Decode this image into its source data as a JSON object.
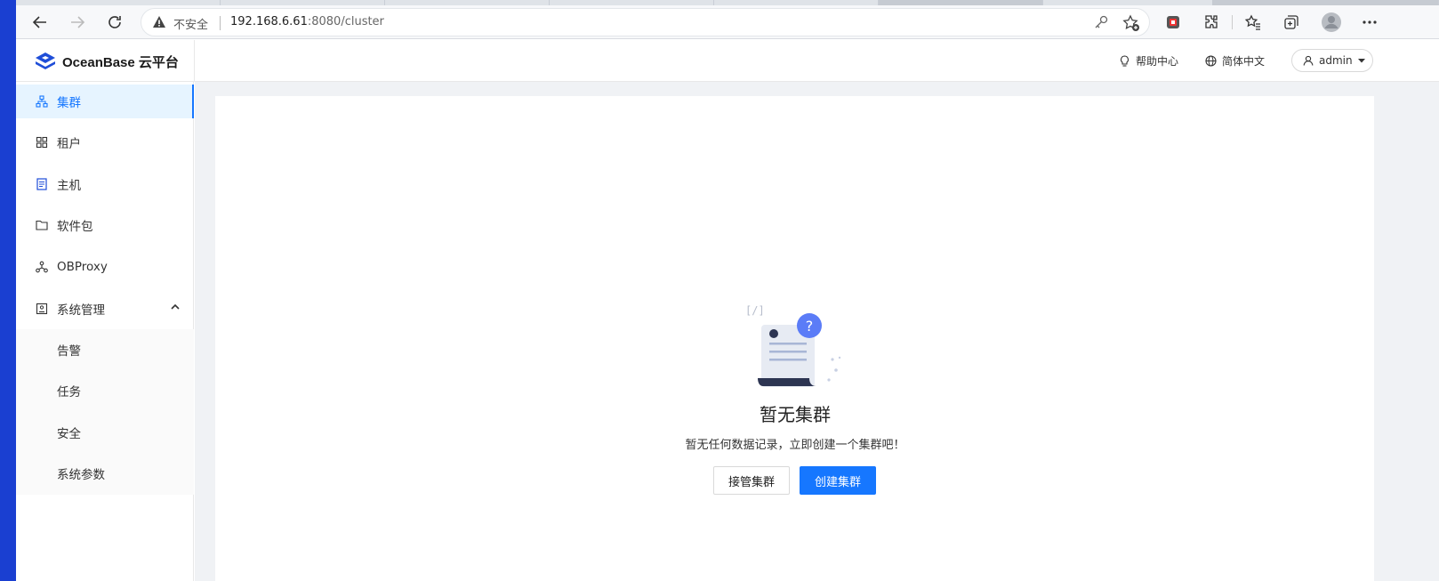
{
  "browser": {
    "security_label": "不安全",
    "url_host": "192.168.6.61",
    "url_port": ":8080",
    "url_path": "/cluster"
  },
  "app": {
    "logo_text": "OceanBase 云平台",
    "header": {
      "help_label": "帮助中心",
      "language_label": "简体中文",
      "user_label": "admin"
    }
  },
  "sidebar": {
    "items": [
      {
        "label": "集群",
        "icon": "cluster-icon",
        "active": true
      },
      {
        "label": "租户",
        "icon": "tenant-icon"
      },
      {
        "label": "主机",
        "icon": "host-icon"
      },
      {
        "label": "软件包",
        "icon": "folder-icon"
      },
      {
        "label": "OBProxy",
        "icon": "proxy-icon"
      },
      {
        "label": "系统管理",
        "icon": "system-icon",
        "expanded": true
      }
    ],
    "subitems": [
      {
        "label": "告警"
      },
      {
        "label": "任务"
      },
      {
        "label": "安全"
      },
      {
        "label": "系统参数"
      }
    ]
  },
  "empty": {
    "title": "暂无集群",
    "description": "暂无任何数据记录，立即创建一个集群吧！",
    "takeover_button": "接管集群",
    "create_button": "创建集群"
  },
  "colors": {
    "primary": "#1677ff",
    "active_bg": "#e6f4ff",
    "page_bg": "#f0f2f5"
  }
}
